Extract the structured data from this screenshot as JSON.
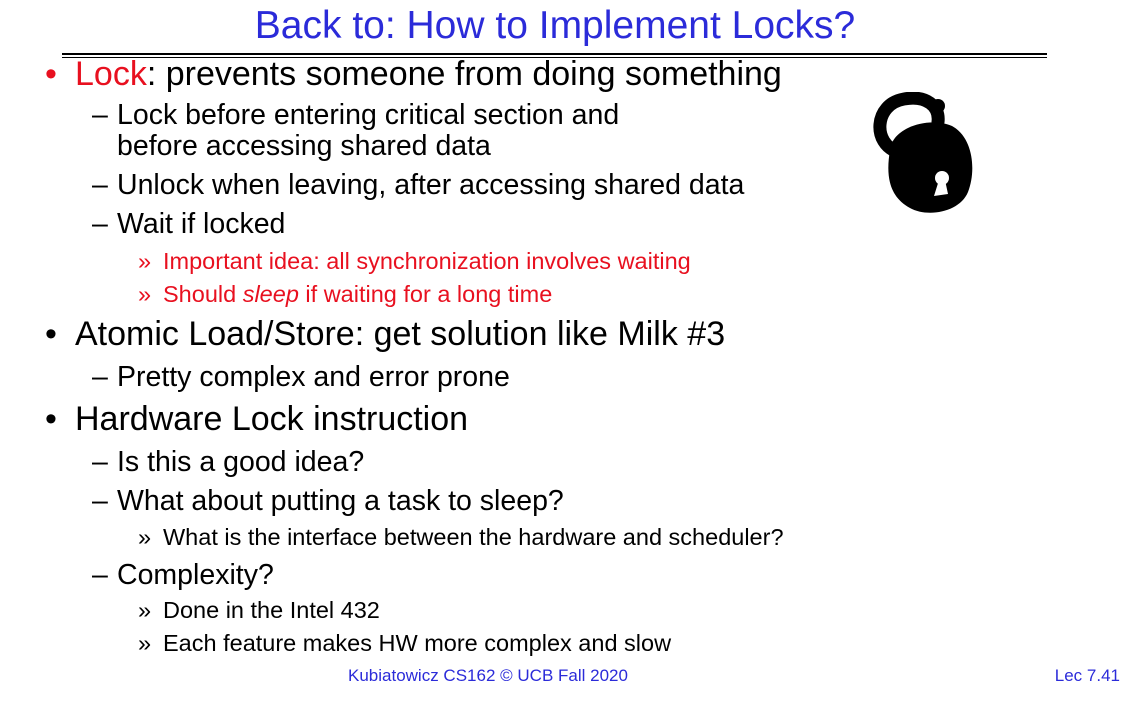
{
  "slide": {
    "title": "Back to: How to Implement Locks?",
    "bullets": [
      {
        "marker": "•",
        "lead": "Lock",
        "text": ": prevents someone from doing something",
        "subs": [
          {
            "marker": "–",
            "line1": "Lock before entering critical section and",
            "line2": "before accessing shared data"
          },
          {
            "marker": "–",
            "text": "Unlock when leaving, after accessing shared data"
          },
          {
            "marker": "–",
            "text": "Wait if locked",
            "subs": [
              {
                "marker": "»",
                "text": "Important idea: all synchronization involves waiting"
              },
              {
                "marker": "»",
                "pre": "Should ",
                "em": "sleep",
                "post": " if waiting for a long time"
              }
            ]
          }
        ]
      },
      {
        "marker": "•",
        "text": "Atomic Load/Store: get solution like Milk #3",
        "subs": [
          {
            "marker": "–",
            "text": "Pretty complex and error prone"
          }
        ]
      },
      {
        "marker": "•",
        "text": "Hardware Lock instruction",
        "subs": [
          {
            "marker": "–",
            "text": "Is this a good idea?"
          },
          {
            "marker": "–",
            "text": "What about putting a task to sleep?",
            "subs": [
              {
                "marker": "»",
                "text": "What is the interface between the hardware and scheduler?"
              }
            ]
          },
          {
            "marker": "–",
            "text": "Complexity?",
            "subs": [
              {
                "marker": "»",
                "text": "Done in the Intel 432"
              },
              {
                "marker": "»",
                "text": "Each feature makes HW more complex and slow"
              }
            ]
          }
        ]
      }
    ],
    "footer": {
      "center": "Kubiatowicz CS162 © UCB Fall 2020",
      "right": "Lec 7.41"
    },
    "icons": {
      "lock": "open-padlock-icon"
    },
    "colors": {
      "title": "#2b2bd9",
      "accent_red": "#e8101f",
      "text": "#000000"
    }
  }
}
